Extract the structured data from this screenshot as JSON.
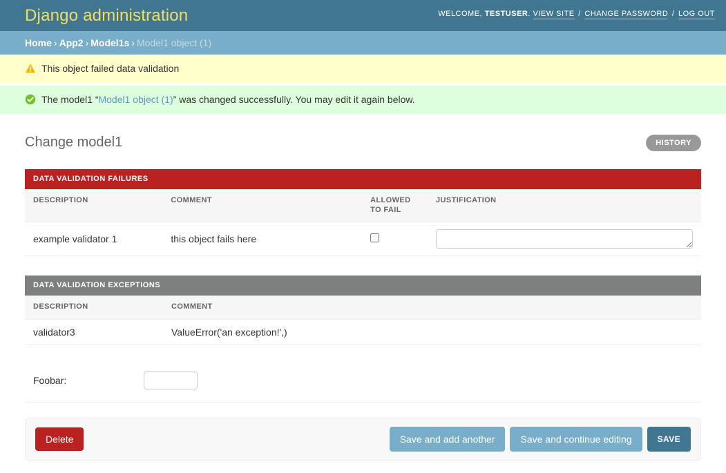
{
  "header": {
    "site_title": "Django administration",
    "welcome_prefix": "Welcome,",
    "username": "testuser",
    "view_site": "View site",
    "change_password": "Change password",
    "log_out": "Log out",
    "separator": "/",
    "period": "."
  },
  "breadcrumbs": {
    "home": "Home",
    "app": "App2",
    "model": "Model1s",
    "current": "Model1 object (1)",
    "chevron": "›"
  },
  "messages": [
    {
      "level": "warning",
      "icon": "warning-triangle-icon",
      "text": "This object failed data validation"
    },
    {
      "level": "success",
      "icon": "success-check-icon",
      "text_before": "The model1 “",
      "link": "Model1 object (1)",
      "text_after": "” was changed successfully. You may edit it again below."
    }
  ],
  "content": {
    "title": "Change model1",
    "history_label": "History"
  },
  "failures_module": {
    "heading": "Data validation failures",
    "columns": [
      "Description",
      "Comment",
      "Allowed to fail",
      "Justification"
    ],
    "rows": [
      {
        "description": "example validator 1",
        "comment": "this object fails here",
        "allowed_to_fail": false,
        "justification": ""
      }
    ]
  },
  "exceptions_module": {
    "heading": "Data validation exceptions",
    "columns": [
      "Description",
      "Comment"
    ],
    "rows": [
      {
        "description": "validator3",
        "comment": "ValueError('an exception!',)"
      }
    ]
  },
  "form": {
    "foobar_label": "Foobar:",
    "foobar_value": ""
  },
  "submit_row": {
    "delete": "Delete",
    "save_and_add_another": "Save and add another",
    "save_and_continue": "Save and continue editing",
    "save": "Save"
  },
  "colors": {
    "header_bg": "#417690",
    "breadcrumb_bg": "#79aec8",
    "brand_text": "#f5dd5d",
    "warning_bg": "#ffffcc",
    "success_bg": "#ddffdd",
    "failures_bg": "#ba2121",
    "exceptions_bg": "#7d807f",
    "delete_bg": "#ba2121",
    "save_bg": "#417690",
    "save_alt_bg": "#79aec8",
    "history_bg": "#999999"
  }
}
